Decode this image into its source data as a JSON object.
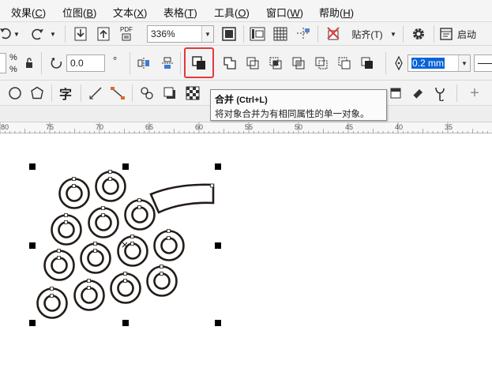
{
  "menu": [
    {
      "label": "效果",
      "key": "C"
    },
    {
      "label": "位图",
      "key": "B"
    },
    {
      "label": "文本",
      "key": "X"
    },
    {
      "label": "表格",
      "key": "T"
    },
    {
      "label": "工具",
      "key": "O"
    },
    {
      "label": "窗口",
      "key": "W"
    },
    {
      "label": "帮助",
      "key": "H"
    }
  ],
  "toolbar1": {
    "zoom_value": "336%",
    "pdf_label": "PDF",
    "snap_label": "贴齐(T)",
    "launch_label": "启动"
  },
  "toolbar2": {
    "percent_top": "%",
    "percent_bottom": "%",
    "rotation_value": "0.0",
    "degree_symbol": "°",
    "outline_width": "0.2 mm"
  },
  "toolbar3": {
    "text_tool_glyph": "字",
    "plus_glyph": "+"
  },
  "tooltip": {
    "title": "合并",
    "shortcut": "(Ctrl+L)",
    "description": "将对象合并为有相同属性的单一对象。"
  },
  "ruler": {
    "labels": [
      "80",
      "75",
      "70",
      "65",
      "60",
      "55",
      "50",
      "45",
      "40",
      "35"
    ]
  },
  "colors": {
    "highlight": "#e23a3a",
    "selection_text_bg": "#0a64d8",
    "shape_stroke": "#231c18"
  }
}
